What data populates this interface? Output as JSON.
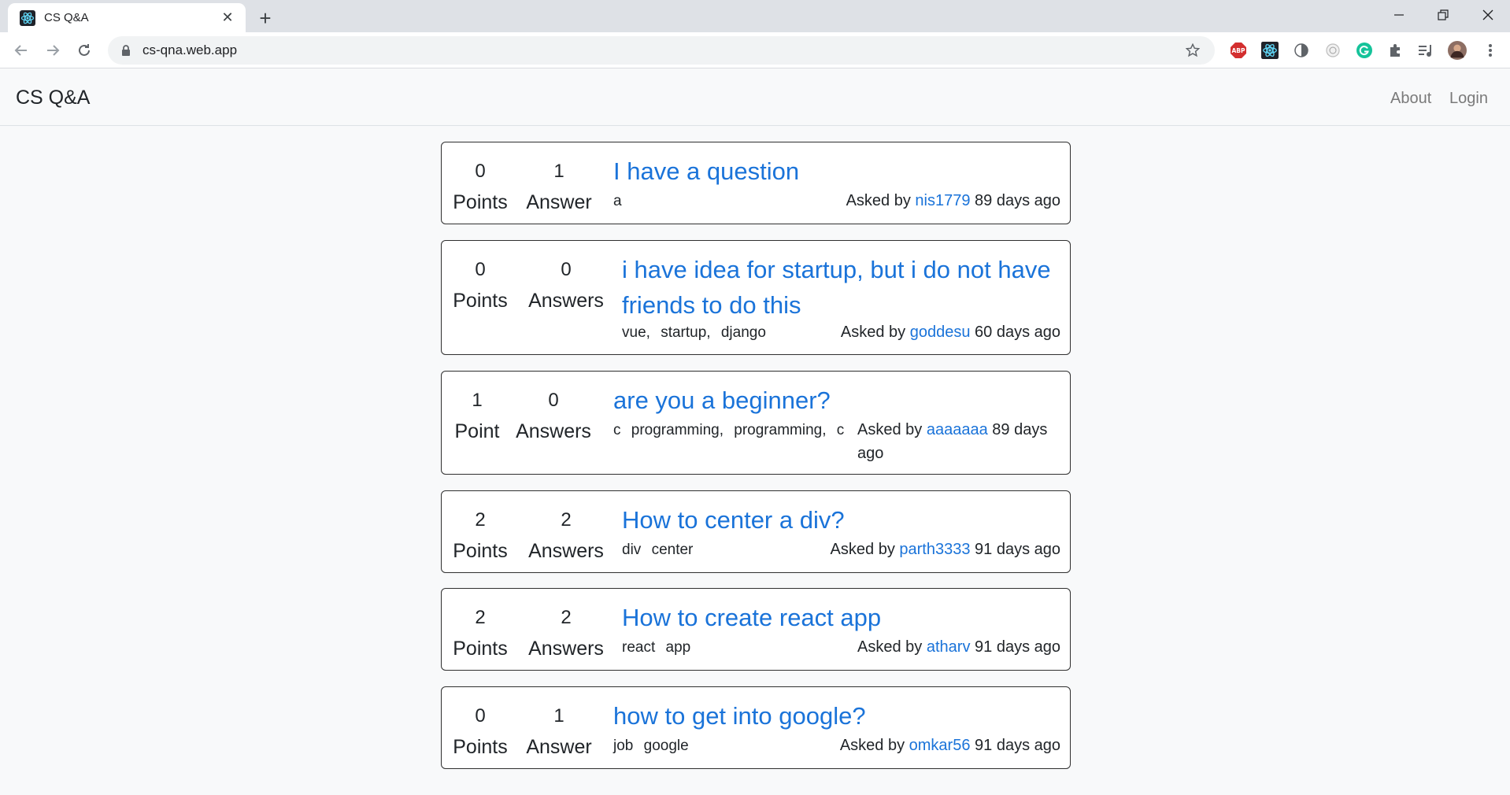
{
  "browser": {
    "tab_title": "CS Q&A",
    "url": "cs-qna.web.app"
  },
  "app": {
    "brand": "CS Q&A",
    "nav": {
      "about": "About",
      "login": "Login"
    }
  },
  "questions": [
    {
      "points": "0",
      "points_label": "Points",
      "answers": "1",
      "answers_label": "Answer",
      "title_lines": [
        "I have a question"
      ],
      "tags": [
        "a"
      ],
      "asked_prefix": "Asked by",
      "user": "nis1779",
      "when": "89 days ago"
    },
    {
      "points": "0",
      "points_label": "Points",
      "answers": "0",
      "answers_label": "Answers",
      "title_lines": [
        "i have idea for startup, but i do not have",
        "friends to do this"
      ],
      "tags": [
        "vue,",
        "startup,",
        "django"
      ],
      "asked_prefix": "Asked by",
      "user": "goddesu",
      "when": "60 days ago"
    },
    {
      "points": "1",
      "points_label": "Point",
      "answers": "0",
      "answers_label": "Answers",
      "title_lines": [
        "are you a beginner?"
      ],
      "tags": [
        "c",
        "programming,",
        "programming,",
        "c"
      ],
      "asked_prefix": "Asked by",
      "user": "aaaaaaa",
      "when": "89 days",
      "when_line2": "ago"
    },
    {
      "points": "2",
      "points_label": "Points",
      "answers": "2",
      "answers_label": "Answers",
      "title_lines": [
        "How to center a div?"
      ],
      "tags": [
        "div",
        "center"
      ],
      "asked_prefix": "Asked by",
      "user": "parth3333",
      "when": "91 days ago"
    },
    {
      "points": "2",
      "points_label": "Points",
      "answers": "2",
      "answers_label": "Answers",
      "title_lines": [
        "How to create react app"
      ],
      "tags": [
        "react",
        "app"
      ],
      "asked_prefix": "Asked by",
      "user": "atharv",
      "when": "91 days ago"
    },
    {
      "points": "0",
      "points_label": "Points",
      "answers": "1",
      "answers_label": "Answer",
      "title_lines": [
        "how to get into google?"
      ],
      "tags": [
        "job",
        "google"
      ],
      "asked_prefix": "Asked by",
      "user": "omkar56",
      "when": "91 days ago"
    }
  ],
  "colors": {
    "link": "#1a73d9",
    "card_border": "#2f2f2f",
    "page_bg": "#f8f9fa"
  },
  "icons": {
    "favicon": "react-atom-icon",
    "extensions": [
      "adblock-plus-icon",
      "react-devtools-icon",
      "dark-circle-icon",
      "timer-icon",
      "grammarly-icon",
      "puzzle-extensions-icon",
      "media-queue-icon",
      "profile-avatar"
    ]
  }
}
